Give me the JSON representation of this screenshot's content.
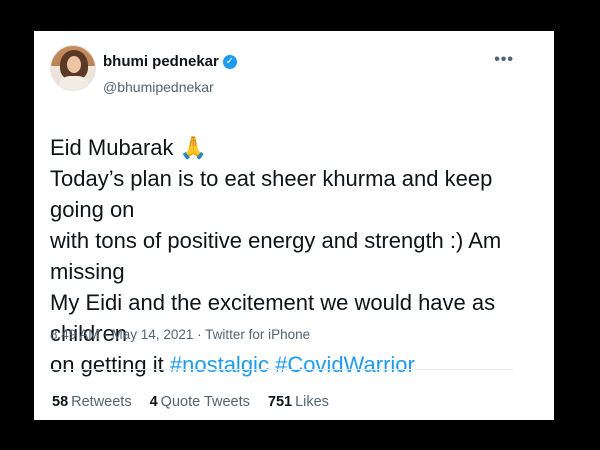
{
  "user": {
    "display_name": "bhumi pednekar",
    "handle": "@bhumipednekar",
    "verified_icon": "verified-badge-icon",
    "avatar_icon": "profile-photo"
  },
  "menu": {
    "more_label": "•••"
  },
  "tweet": {
    "line1": "Eid Mubarak 🙏",
    "line2": "Today’s plan is to eat sheer khurma and keep going on",
    "line3": "with tons of positive energy and strength :) Am missing",
    "line4": "My Eidi and the excitement we would have as children",
    "line5_text": "on getting it ",
    "hashtag1": "#nostalgic",
    "hashtag2": "#CovidWarrior"
  },
  "meta": {
    "time": "8:49 AM",
    "date": "May 14, 2021",
    "source": "Twitter for iPhone"
  },
  "stats": {
    "retweets_count": "58",
    "retweets_label": "Retweets",
    "quotes_count": "4",
    "quotes_label": "Quote Tweets",
    "likes_count": "751",
    "likes_label": "Likes"
  },
  "colors": {
    "accent": "#1d9bf0",
    "text": "#0f1419",
    "secondary": "#536471",
    "background": "#000000"
  }
}
